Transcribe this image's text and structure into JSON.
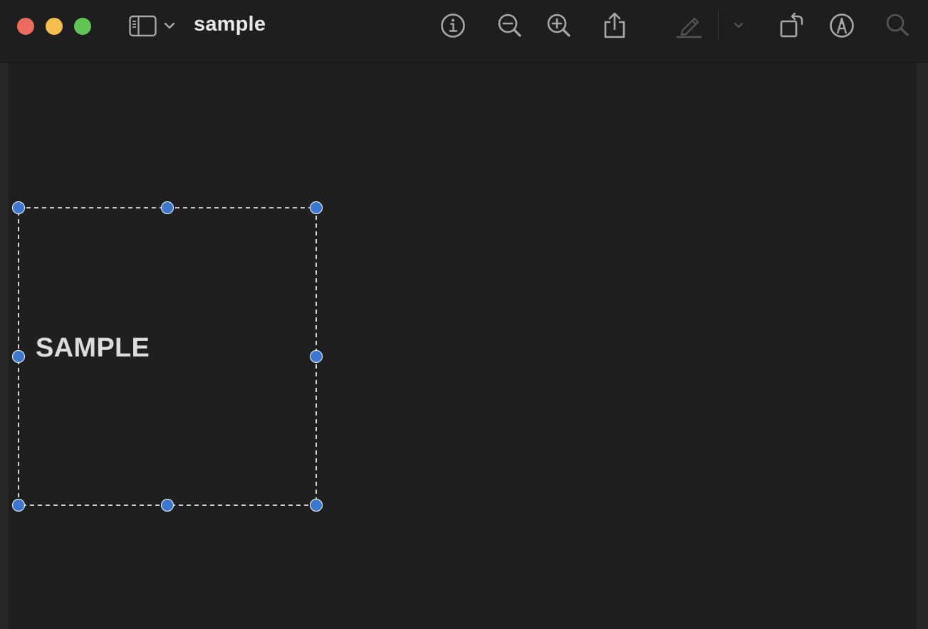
{
  "window": {
    "title": "sample",
    "traffic_lights": {
      "close_color": "#ed6a5e",
      "minimize_color": "#f5bf4f",
      "maximize_color": "#61c554"
    }
  },
  "toolbar": {
    "sidebar_toggle_icon": "sidebar-icon",
    "sidebar_menu_icon": "chevron-down-icon",
    "buttons": [
      {
        "icon": "info-icon",
        "enabled": true
      },
      {
        "icon": "zoom-out-icon",
        "enabled": true
      },
      {
        "icon": "zoom-in-icon",
        "enabled": true
      },
      {
        "icon": "share-icon",
        "enabled": true
      },
      {
        "icon": "highlight-pen-icon",
        "enabled": false
      },
      {
        "icon": "chevron-down-icon",
        "enabled": false
      },
      {
        "icon": "rotate-icon",
        "enabled": true
      },
      {
        "icon": "markup-icon",
        "enabled": true
      },
      {
        "icon": "search-icon",
        "enabled": false
      }
    ]
  },
  "document": {
    "annotation_text": "SAMPLE",
    "selection_handle_color": "#3c78d0"
  }
}
